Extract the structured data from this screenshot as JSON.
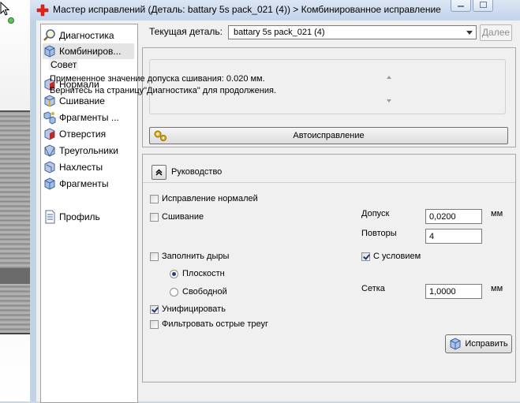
{
  "window": {
    "title": "Мастер исправлений (Деталь: battary 5s pack_021 (4)) > Комбинированное исправление"
  },
  "nav": {
    "items": [
      {
        "label": "Диагностика",
        "icon": "magnifier-icon",
        "selected": false
      },
      {
        "label": "Комбиниров...",
        "icon": "cube-icon",
        "selected": true
      },
      {
        "label": "Нормали",
        "icon": "normals-icon",
        "selected": false
      },
      {
        "label": "Сшивание",
        "icon": "stitch-icon",
        "selected": false
      },
      {
        "label": "Фрагменты ...",
        "icon": "fragments-icon",
        "selected": false
      },
      {
        "label": "Отверстия",
        "icon": "holes-icon",
        "selected": false
      },
      {
        "label": "Треугольники",
        "icon": "triangles-icon",
        "selected": false
      },
      {
        "label": "Нахлесты",
        "icon": "overlaps-icon",
        "selected": false
      },
      {
        "label": "Фрагменты",
        "icon": "shells-icon",
        "selected": false
      },
      {
        "label": "Профиль",
        "icon": "document-icon",
        "selected": false
      }
    ]
  },
  "part_selector": {
    "label": "Текущая деталь:",
    "value": "battary 5s pack_021 (4)",
    "next_label": "Далее"
  },
  "advice": {
    "title": "Совет",
    "line1": "Примененное значение допуска сшивания: 0.020 мм.",
    "line2": "Вернитесь на страницу\"Диагностика\" для продолжения."
  },
  "autofix": {
    "label": "Автоисправление"
  },
  "guide": {
    "title": "Руководство",
    "fix_normals": {
      "label": "Исправление нормалей",
      "checked": false
    },
    "stitching": {
      "label": "Сшивание",
      "checked": false
    },
    "tolerance": {
      "label": "Допуск",
      "value": "0,0200",
      "unit": "мм"
    },
    "repeats": {
      "label": "Повторы",
      "value": "4"
    },
    "fill_holes": {
      "label": "Заполнить дыры",
      "checked": false
    },
    "conditional": {
      "label": "С условием",
      "checked": true
    },
    "planar": {
      "label": "Плоскостн",
      "selected": true
    },
    "freeform": {
      "label": "Свободной",
      "selected": false
    },
    "grid": {
      "label": "Сетка",
      "value": "1,0000",
      "unit": "мм"
    },
    "unify": {
      "label": "Унифицировать",
      "checked": true
    },
    "filter_sharp": {
      "label": "Фильтровать острые треуг",
      "checked": false
    },
    "apply_label": "Исправить"
  }
}
